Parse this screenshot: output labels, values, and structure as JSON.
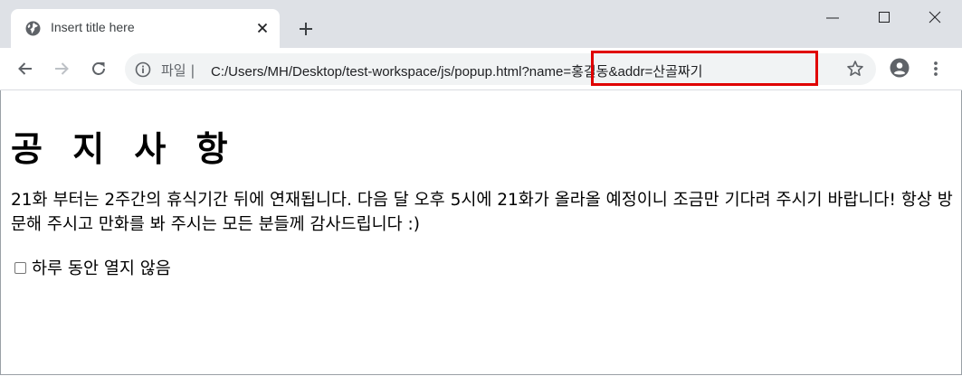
{
  "tab": {
    "title": "Insert title here",
    "icon": "globe-icon"
  },
  "toolbar": {
    "url_scheme": "파일 |",
    "url_path": "C:/Users/MH/Desktop/test-workspace/js/popup.html",
    "url_query": "?name=홍길동&addr=산골짜기"
  },
  "page": {
    "title": "공 지 사 항",
    "body": "21화 부터는 2주간의 휴식기간 뒤에 연재됩니다. 다음 달 오후 5시에 21화가 올라올 예정이니 조금만 기다려 주시기 바랍니다! 항상 방문해 주시고 만화를 봐 주시는 모든 분들께 감사드립니다 :)",
    "checkbox_label": "하루 동안 열지 않음",
    "checkbox_checked": false
  },
  "colors": {
    "highlight": "#e00000",
    "tabstrip": "#dee1e6",
    "omnibox": "#f1f3f4"
  }
}
